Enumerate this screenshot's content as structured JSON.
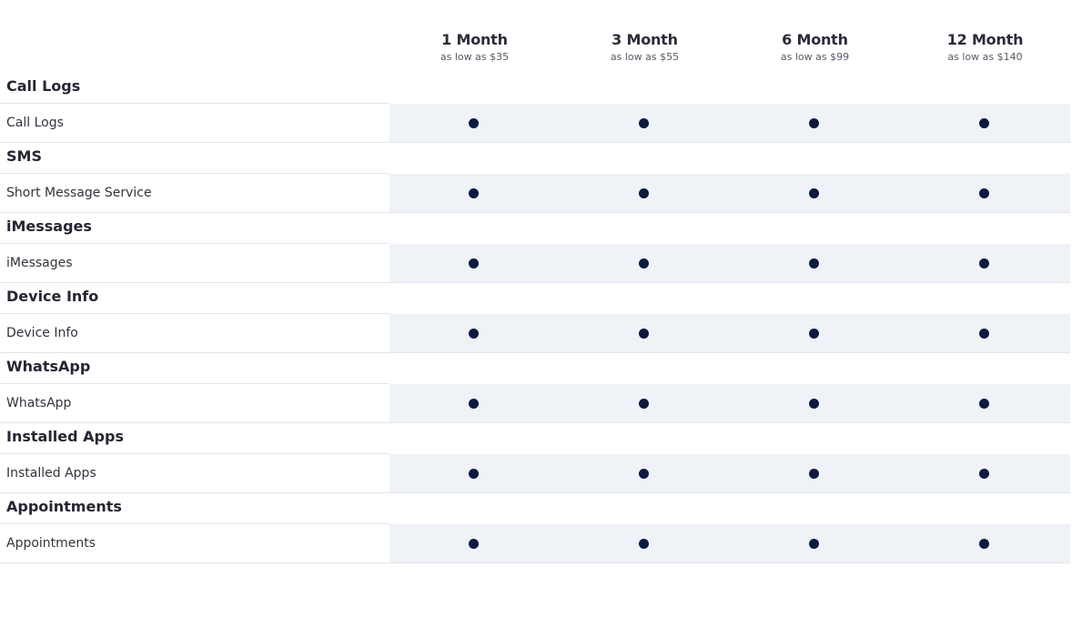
{
  "plans": [
    {
      "title": "1 Month",
      "price": "as low as $35"
    },
    {
      "title": "3 Month",
      "price": "as low as $55"
    },
    {
      "title": "6 Month",
      "price": "as low as $99"
    },
    {
      "title": "12 Month",
      "price": "as low as $140"
    }
  ],
  "sections": [
    {
      "title": "Call Logs",
      "feature": "Call Logs",
      "included": [
        true,
        true,
        true,
        true
      ]
    },
    {
      "title": "SMS",
      "feature": "Short Message Service",
      "included": [
        true,
        true,
        true,
        true
      ]
    },
    {
      "title": "iMessages",
      "feature": "iMessages",
      "included": [
        true,
        true,
        true,
        true
      ]
    },
    {
      "title": "Device Info",
      "feature": "Device Info",
      "included": [
        true,
        true,
        true,
        true
      ]
    },
    {
      "title": "WhatsApp",
      "feature": "WhatsApp",
      "included": [
        true,
        true,
        true,
        true
      ]
    },
    {
      "title": "Installed Apps",
      "feature": "Installed Apps",
      "included": [
        true,
        true,
        true,
        true
      ]
    },
    {
      "title": "Appointments",
      "feature": "Appointments",
      "included": [
        true,
        true,
        true,
        true
      ]
    }
  ],
  "colors": {
    "dot": "#0d1a3f",
    "cell_background": "#eff2f7",
    "divider": "#e3e6ea"
  },
  "icons": {
    "included": "filled-dot-icon"
  }
}
